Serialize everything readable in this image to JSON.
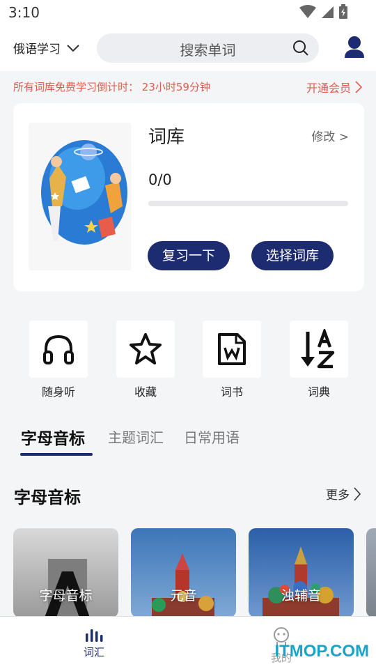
{
  "status_bar": {
    "time": "3:10"
  },
  "header": {
    "language_label": "俄语学习",
    "search_placeholder": "搜索单词"
  },
  "promo": {
    "countdown_text": "所有词库免费学习倒计时：  23小时59分钟",
    "vip_link": "开通会员"
  },
  "card": {
    "title": "词库",
    "edit_label": "修改 >",
    "progress_text": "0/0",
    "progress_fraction": 0,
    "review_button": "复习一下",
    "choose_button": "选择词库"
  },
  "features": [
    {
      "label": "随身听",
      "icon": "headphones-icon"
    },
    {
      "label": "收藏",
      "icon": "star-icon"
    },
    {
      "label": "词书",
      "icon": "word-doc-icon"
    },
    {
      "label": "词典",
      "icon": "sort-az-icon"
    }
  ],
  "tabs": [
    {
      "label": "字母音标",
      "active": true
    },
    {
      "label": "主题词汇",
      "active": false
    },
    {
      "label": "日常用语",
      "active": false
    }
  ],
  "section": {
    "title": "字母音标",
    "more_label": "更多"
  },
  "tiles": [
    {
      "label": "字母音标"
    },
    {
      "label": "元音"
    },
    {
      "label": "浊辅音"
    }
  ],
  "tabbar": {
    "items": [
      {
        "label": "词汇",
        "icon": "bar-chart-icon",
        "active": true
      },
      {
        "label": "我的",
        "icon": "robot-icon",
        "active": false
      }
    ]
  },
  "watermark": "ITMOP.COM",
  "colors": {
    "accent": "#1d2b70",
    "promo_red": "#e35a4e",
    "background": "#f4f5f7"
  }
}
